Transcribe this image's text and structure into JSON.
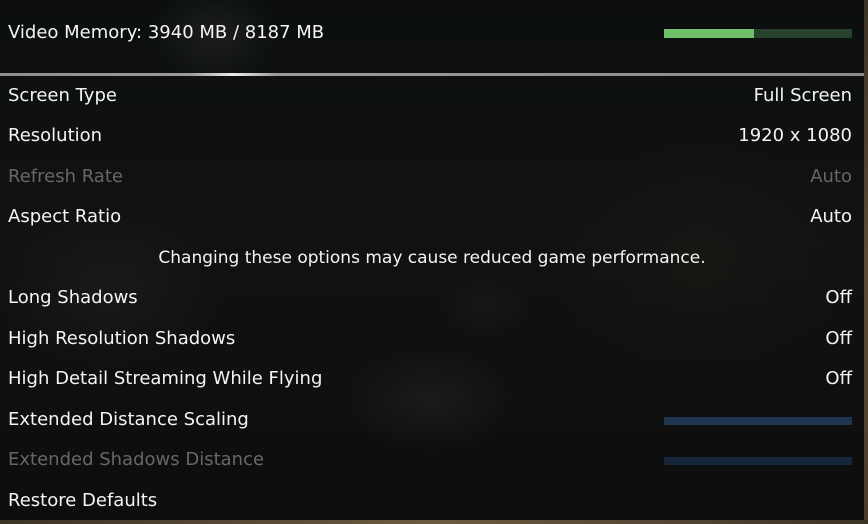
{
  "video_memory": {
    "label": "Video Memory: 3940 MB / 8187 MB",
    "used_mb": 3940,
    "total_mb": 8187,
    "bar_fill_fraction": 0.48,
    "bar_color": "#6fc06a",
    "bar_track_color": "#27422c"
  },
  "settings": [
    {
      "label": "Screen Type",
      "value": "Full Screen"
    },
    {
      "label": "Resolution",
      "value": "1920 x 1080"
    },
    {
      "label": "Refresh Rate",
      "value": "Auto"
    },
    {
      "label": "Aspect Ratio",
      "value": "Auto"
    }
  ],
  "warning": "Changing these options may cause reduced game performance.",
  "advanced": [
    {
      "label": "Long Shadows",
      "value": "Off"
    },
    {
      "label": "High Resolution Shadows",
      "value": "Off"
    },
    {
      "label": "High Detail Streaming While Flying",
      "value": "Off"
    },
    {
      "label": "Extended Distance Scaling",
      "slider_level": 0
    },
    {
      "label": "Extended Shadows Distance",
      "slider_level": 0
    }
  ],
  "restore_defaults": "Restore Defaults",
  "colors": {
    "text": "#f4f4f4",
    "disabled_text": "#666866",
    "slider_track": "#1e3550"
  }
}
